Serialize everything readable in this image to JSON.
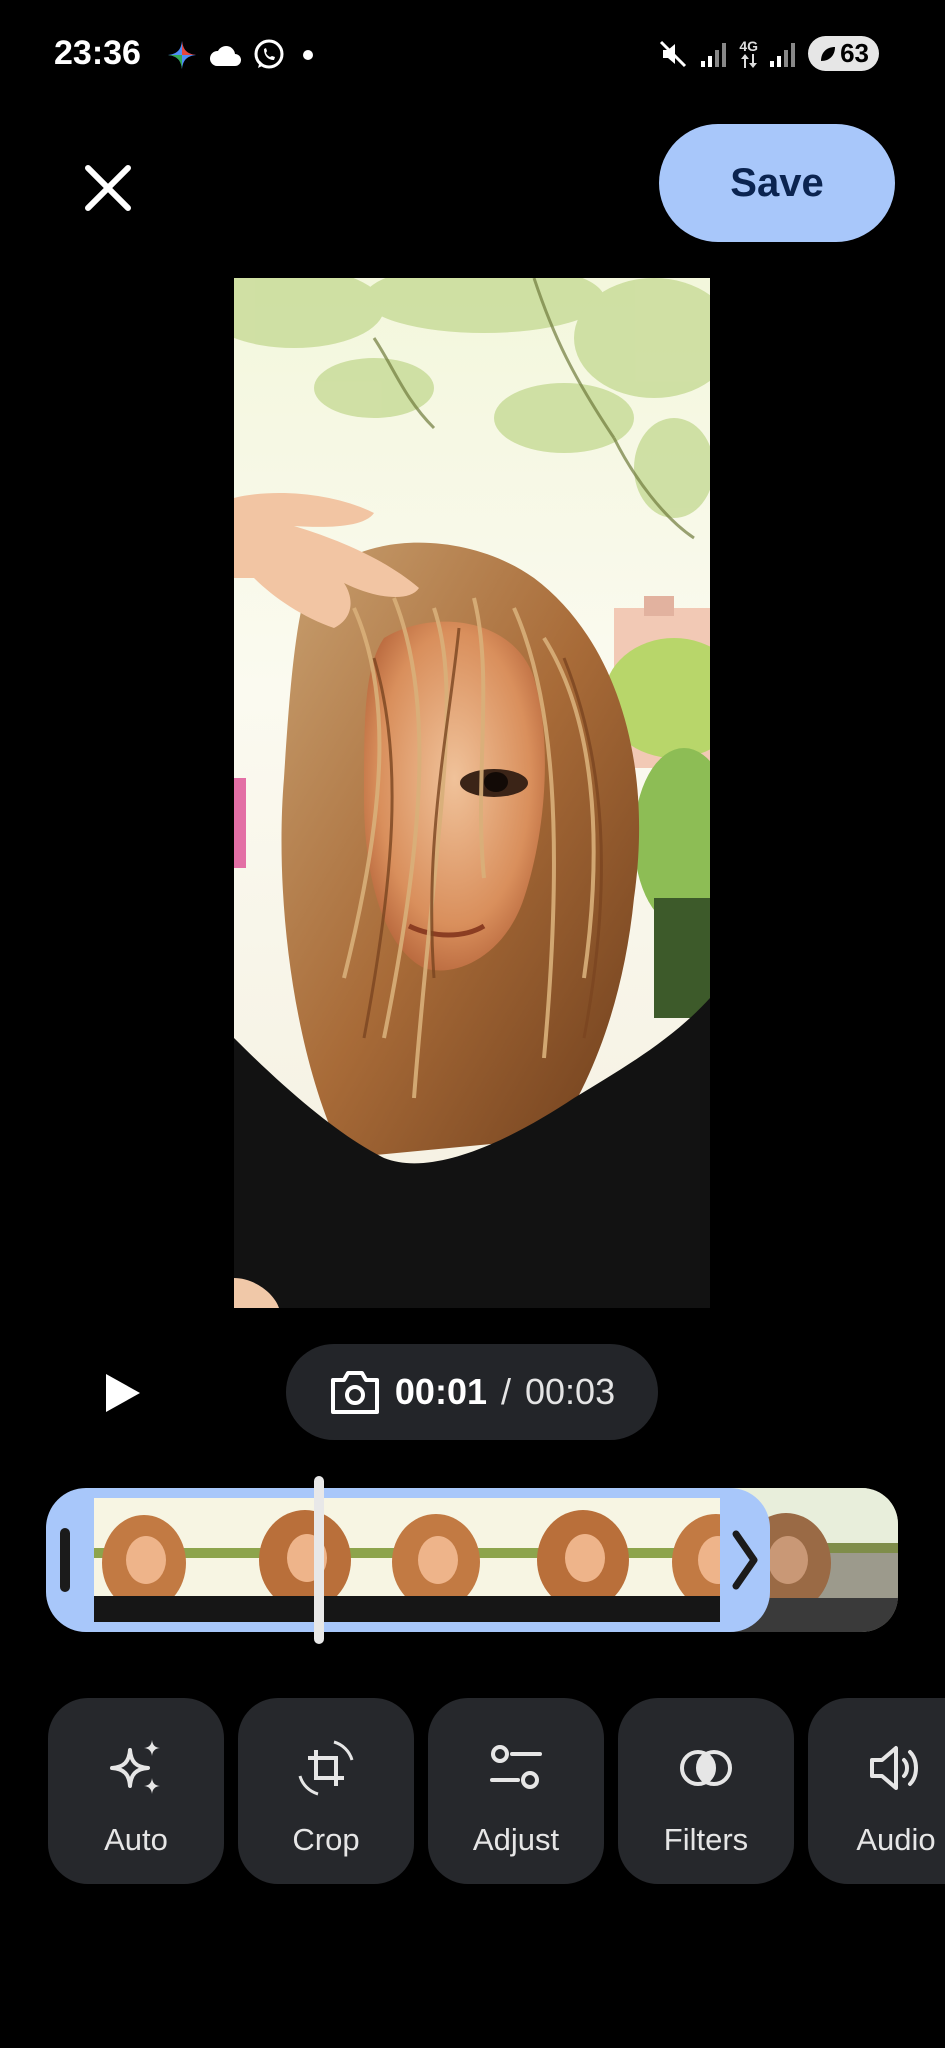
{
  "status_bar": {
    "time": "23:36",
    "network_label": "4G",
    "battery_level": "63"
  },
  "header": {
    "close_icon": "close-icon",
    "save_label": "Save"
  },
  "player": {
    "current_time": "00:01",
    "separator": "/",
    "total_time": "00:03",
    "play_icon": "play-icon",
    "snapshot_icon": "camera-icon"
  },
  "timeline": {
    "playhead_fraction": 0.36
  },
  "tools": [
    {
      "label": "Auto",
      "icon": "sparkle-icon"
    },
    {
      "label": "Crop",
      "icon": "crop-rotate-icon"
    },
    {
      "label": "Adjust",
      "icon": "adjust-sliders-icon"
    },
    {
      "label": "Filters",
      "icon": "filters-icon"
    },
    {
      "label": "Audio",
      "icon": "speaker-icon"
    }
  ],
  "colors": {
    "accent": "#a8c7fa",
    "background": "#000000",
    "tool_bg": "#26282c"
  }
}
